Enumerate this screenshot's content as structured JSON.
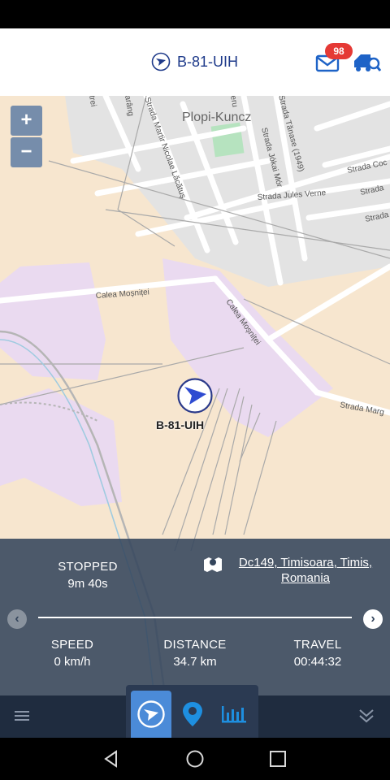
{
  "header": {
    "vehicle_title": "B-81-UIH",
    "message_count": "98"
  },
  "map": {
    "zoom_in_label": "+",
    "zoom_out_label": "−",
    "vehicle_label": "B-81-UIH",
    "place_labels": {
      "plopi": "Plopi-Kuncz",
      "calea_mosnitei_1": "Calea Moșniței",
      "calea_mosnitei_2": "Calea Moșniței",
      "strada_jules_verne": "Strada Jules Verne",
      "strada_jokai_mor": "Strada Jókai Mór",
      "strada_martir": "Strada Martir Nicolae Lăcătuș",
      "strada_marg": "Strada Marg",
      "strada_coc": "Strada Coc",
      "strada_r1": "Strada",
      "strada_r2": "Strada",
      "strada_tanase": "Strada Tănase (1949)",
      "arang": "arâng",
      "trei": "trei",
      "eru": "eru"
    }
  },
  "info": {
    "status_label": "STOPPED",
    "status_value": "9m 40s",
    "address": "Dc149, Timisoara, Timis, Romania",
    "speed_label": "SPEED",
    "speed_value": "0 km/h",
    "distance_label": "DISTANCE",
    "distance_value": "34.7 km",
    "travel_label": "TRAVEL",
    "travel_value": "00:44:32"
  },
  "colors": {
    "header_title": "#1e3a8a",
    "badge": "#e53935",
    "panel": "#34455c",
    "active_tab": "#4b8bd8",
    "map_land": "#f7e6cf",
    "map_urban": "#e0e0e0",
    "map_industrial": "#eadaf0"
  },
  "icons": {
    "vehicle": "navigation-arrow-icon",
    "mail": "mail-icon",
    "fleet": "truck-search-icon",
    "address": "map-pin-icon",
    "tab_track": "navigation-arrow-icon",
    "tab_location": "location-pin-icon",
    "tab_reports": "bar-chart-icon",
    "menu": "hamburger-icon",
    "collapse": "double-chevron-down-icon"
  }
}
